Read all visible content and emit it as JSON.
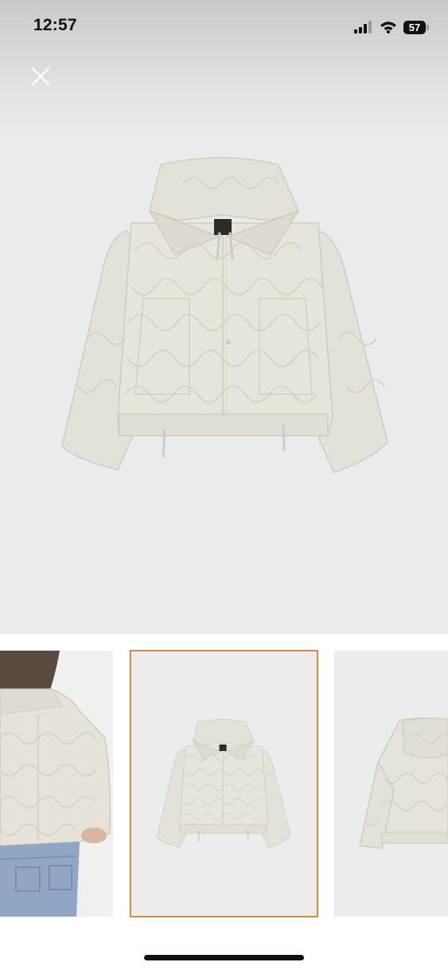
{
  "status_bar": {
    "time": "12:57",
    "battery_level": "57",
    "icons": [
      "cellular-signal-icon",
      "wifi-icon",
      "battery-icon"
    ]
  },
  "viewer": {
    "close_icon": "close-icon",
    "main_image": "jacket-front-image",
    "selected_thumbnail_index": 1,
    "thumbnails": [
      {
        "image": "jacket-back-on-model"
      },
      {
        "image": "jacket-front"
      },
      {
        "image": "jacket-back"
      }
    ]
  },
  "colors": {
    "selection_border": "#e0893a",
    "image_background": "#ebebeb",
    "jacket": "#e4e1d8"
  }
}
